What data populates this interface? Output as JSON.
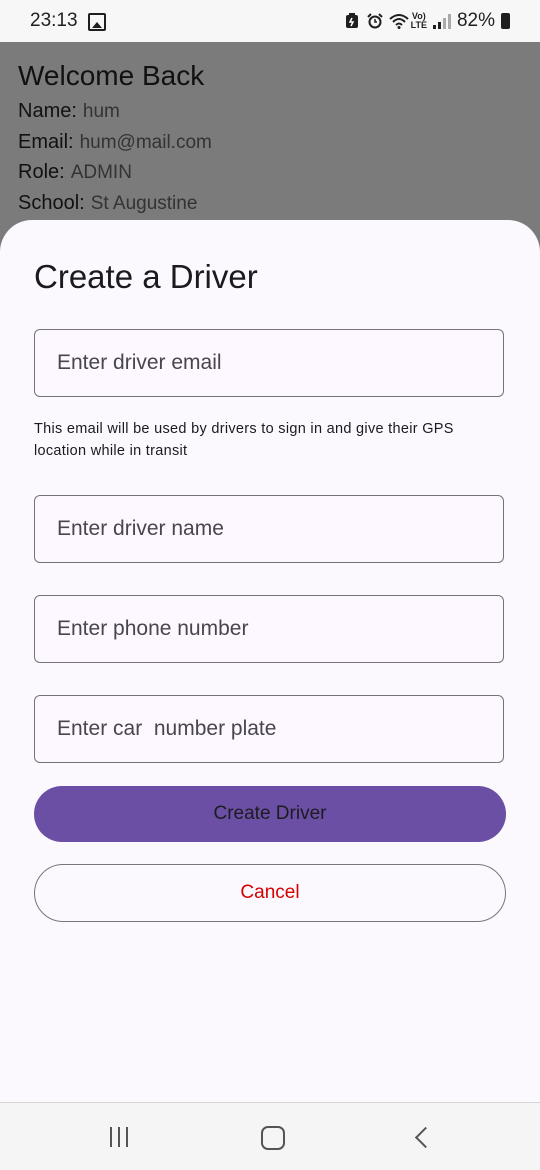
{
  "status_bar": {
    "time": "23:13",
    "battery": "82%",
    "volte_top": "Vo)",
    "volte_bottom": "LTE"
  },
  "background": {
    "title": "Welcome Back",
    "rows": [
      {
        "label": "Name:",
        "value": "hum"
      },
      {
        "label": "Email:",
        "value": "hum@mail.com"
      },
      {
        "label": "Role:",
        "value": "ADMIN"
      },
      {
        "label": "School:",
        "value": "St Augustine"
      }
    ]
  },
  "sheet": {
    "title": "Create a Driver",
    "email_placeholder": "Enter driver email",
    "helper_text": "This email will be used by drivers to sign in and give their GPS location while in transit",
    "name_placeholder": "Enter driver name",
    "phone_placeholder": "Enter phone number",
    "plate_placeholder": "Enter car  number plate",
    "create_label": "Create Driver",
    "cancel_label": "Cancel"
  },
  "colors": {
    "primary": "#6a4fa5",
    "cancel_text": "#d50000"
  }
}
